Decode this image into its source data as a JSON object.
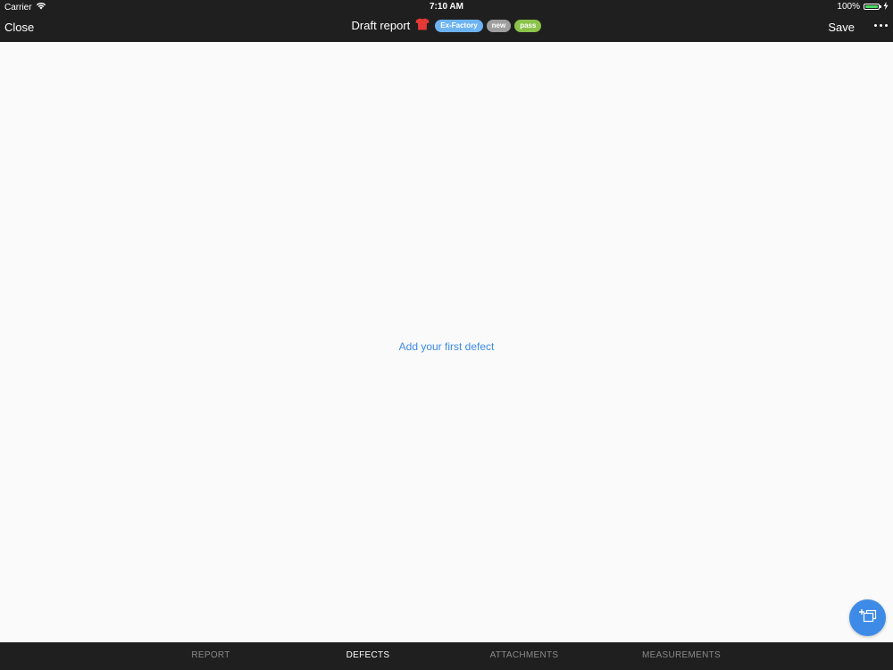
{
  "status_bar": {
    "carrier": "Carrier",
    "time": "7:10 AM",
    "battery": "100%",
    "battery_level": 1.0,
    "icons": [
      "wifi-icon",
      "battery-icon",
      "charging-icon"
    ]
  },
  "nav": {
    "close_label": "Close",
    "title": "Draft report",
    "badges": {
      "type": "Ex-Factory",
      "status": "new",
      "result": "pass"
    },
    "save_label": "Save",
    "icons": [
      "shirt-icon",
      "more-icon"
    ]
  },
  "main": {
    "empty_action": "Add your first defect",
    "fab_icon": "add-defect-icon"
  },
  "tabs": [
    {
      "label": "REPORT",
      "active": false
    },
    {
      "label": "DEFECTS",
      "active": true
    },
    {
      "label": "ATTACHMENTS",
      "active": false
    },
    {
      "label": "MEASUREMENTS",
      "active": false
    }
  ],
  "colors": {
    "bar_background": "#1f1f1f",
    "accent": "#3d8be6",
    "badge_exfactory": "#6db3f2",
    "badge_new": "#9e9e9e",
    "badge_pass": "#8bc34a",
    "shirt": "#e53935",
    "battery": "#4cd964"
  }
}
